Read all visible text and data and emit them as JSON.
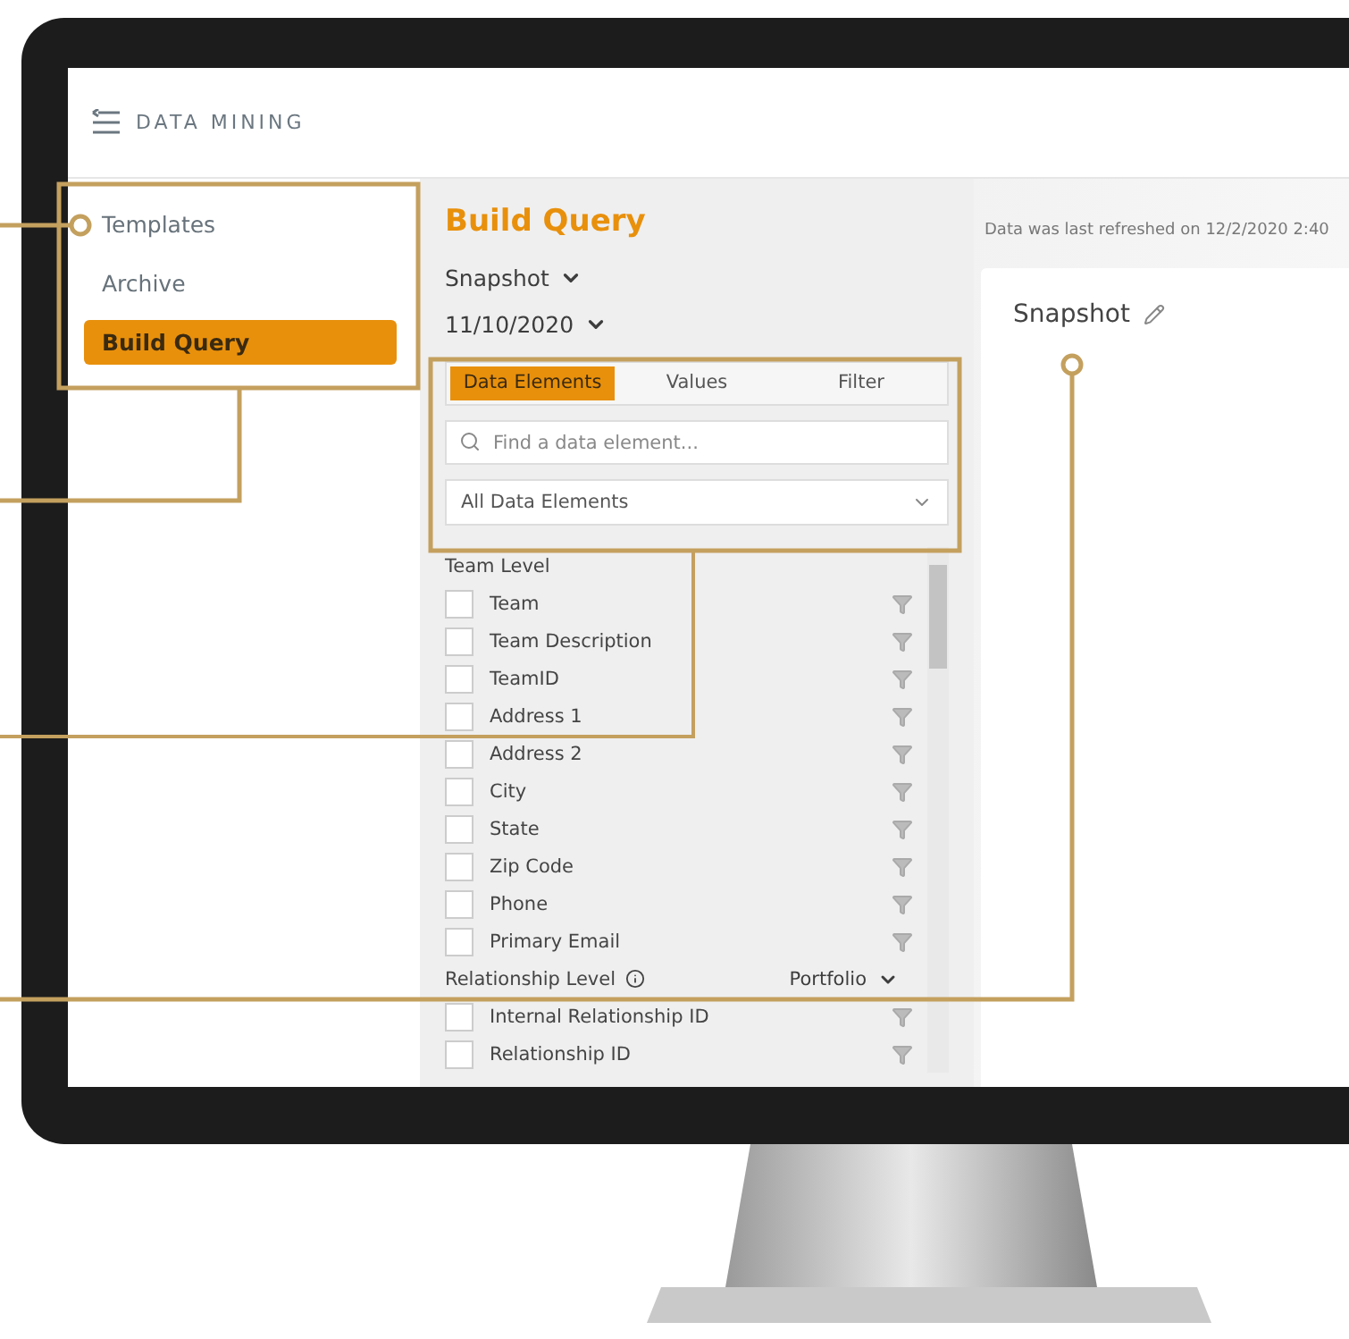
{
  "header": {
    "title": "DATA MINING"
  },
  "sidebar": {
    "items": [
      {
        "label": "Templates",
        "selected": false
      },
      {
        "label": "Archive",
        "selected": false
      },
      {
        "label": "Build Query",
        "selected": true
      }
    ]
  },
  "query": {
    "title": "Build Query",
    "type_dropdown": "Snapshot",
    "date_dropdown": "11/10/2020",
    "tabs": [
      {
        "label": "Data Elements",
        "selected": true
      },
      {
        "label": "Values",
        "selected": false
      },
      {
        "label": "Filter",
        "selected": false
      }
    ],
    "search": {
      "placeholder": "Find a data element..."
    },
    "element_filter": "All Data Elements",
    "groups": [
      {
        "title": "Team Level",
        "items": [
          {
            "label": "Team",
            "checked": false
          },
          {
            "label": "Team Description",
            "checked": false
          },
          {
            "label": "TeamID",
            "checked": false
          },
          {
            "label": "Address 1",
            "checked": false
          },
          {
            "label": "Address 2",
            "checked": false
          },
          {
            "label": "City",
            "checked": false
          },
          {
            "label": "State",
            "checked": false
          },
          {
            "label": "Zip Code",
            "checked": false
          },
          {
            "label": "Phone",
            "checked": false
          },
          {
            "label": "Primary Email",
            "checked": false
          }
        ]
      },
      {
        "title": "Relationship Level",
        "level_dropdown": "Portfolio",
        "items": [
          {
            "label": "Internal Relationship ID",
            "checked": false
          },
          {
            "label": "Relationship ID",
            "checked": false
          }
        ]
      }
    ]
  },
  "refresh_note": "Data was last refreshed on 12/2/2020 2:40",
  "card": {
    "title": "Snapshot"
  }
}
